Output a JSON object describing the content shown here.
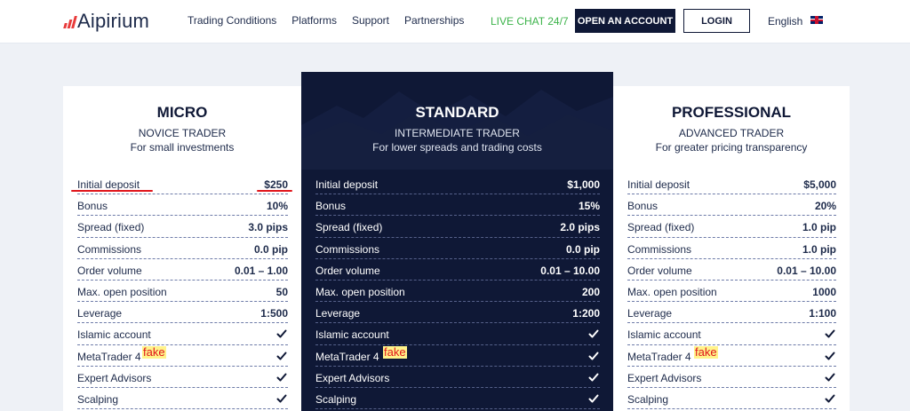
{
  "header": {
    "brand": "Aipirium",
    "nav": [
      "Trading Conditions",
      "Platforms",
      "Support",
      "Partnerships"
    ],
    "live_chat": "LIVE CHAT 24/7",
    "open_account": "OPEN AN ACCOUNT",
    "login": "LOGIN",
    "language": "English",
    "colors": {
      "accent": "#0f1836",
      "live_chat": "#3cb34a",
      "logo_bars": "#e83b3b"
    }
  },
  "plans": [
    {
      "name": "MICRO",
      "level": "NOVICE TRADER",
      "description": "For small investments",
      "rows": [
        {
          "label": "Initial deposit",
          "value": "$250"
        },
        {
          "label": "Bonus",
          "value": "10%"
        },
        {
          "label": "Spread (fixed)",
          "value": "3.0 pips"
        },
        {
          "label": "Commissions",
          "value": "0.0 pip"
        },
        {
          "label": "Order volume",
          "value": "0.01 – 1.00"
        },
        {
          "label": "Max. open position",
          "value": "50"
        },
        {
          "label": "Leverage",
          "value": "1:500"
        },
        {
          "label": "Islamic account",
          "value": "check-icon"
        },
        {
          "label": "MetaTrader 4",
          "value": "check-icon",
          "annotation": "fake"
        },
        {
          "label": "Expert Advisors",
          "value": "check-icon"
        },
        {
          "label": "Scalping",
          "value": "check-icon"
        }
      ]
    },
    {
      "name": "STANDARD",
      "level": "INTERMEDIATE TRADER",
      "description": "For lower spreads and trading costs",
      "rows": [
        {
          "label": "Initial deposit",
          "value": "$1,000"
        },
        {
          "label": "Bonus",
          "value": "15%"
        },
        {
          "label": "Spread (fixed)",
          "value": "2.0 pips"
        },
        {
          "label": "Commissions",
          "value": "0.0 pip"
        },
        {
          "label": "Order volume",
          "value": "0.01 – 10.00"
        },
        {
          "label": "Max. open position",
          "value": "200"
        },
        {
          "label": "Leverage",
          "value": "1:200"
        },
        {
          "label": "Islamic account",
          "value": "check-icon"
        },
        {
          "label": "MetaTrader 4",
          "value": "check-icon",
          "annotation": "fake"
        },
        {
          "label": "Expert Advisors",
          "value": "check-icon"
        },
        {
          "label": "Scalping",
          "value": "check-icon"
        }
      ]
    },
    {
      "name": "PROFESSIONAL",
      "level": "ADVANCED TRADER",
      "description": "For greater pricing transparency",
      "rows": [
        {
          "label": "Initial deposit",
          "value": "$5,000"
        },
        {
          "label": "Bonus",
          "value": "20%"
        },
        {
          "label": "Spread (fixed)",
          "value": "1.0 pip"
        },
        {
          "label": "Commissions",
          "value": "1.0 pip"
        },
        {
          "label": "Order volume",
          "value": "0.01 – 10.00"
        },
        {
          "label": "Max. open position",
          "value": "1000"
        },
        {
          "label": "Leverage",
          "value": "1:100"
        },
        {
          "label": "Islamic account",
          "value": "check-icon"
        },
        {
          "label": "MetaTrader 4",
          "value": "check-icon",
          "annotation": "fake"
        },
        {
          "label": "Expert Advisors",
          "value": "check-icon"
        },
        {
          "label": "Scalping",
          "value": "check-icon"
        }
      ]
    }
  ]
}
